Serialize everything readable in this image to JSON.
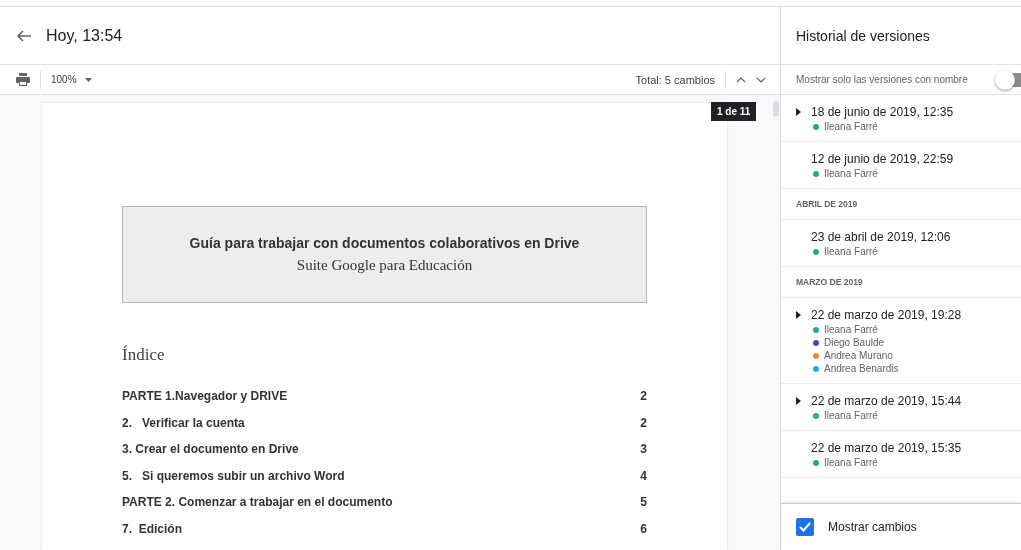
{
  "header": {
    "title": "Hoy, 13:54"
  },
  "toolbar": {
    "zoom": "100%",
    "total": "Total: 5 cambios",
    "tooltip": "1 de 11"
  },
  "document": {
    "title": "Guía para trabajar con documentos colaborativos en Drive",
    "subtitle": "Suite Google para Educación",
    "index_heading": "Índice",
    "toc": [
      {
        "text": "PARTE 1.Navegador y DRIVE",
        "page": "2"
      },
      {
        "text": "2.   Verificar la cuenta",
        "page": "2"
      },
      {
        "text": "3. Crear el documento en Drive",
        "page": "3"
      },
      {
        "text": "5.   Si queremos subir un archivo Word",
        "page": "4"
      },
      {
        "text": "PARTE 2. Comenzar a trabajar en el documento",
        "page": "5"
      },
      {
        "text": "7.  Edición",
        "page": "6"
      }
    ]
  },
  "panel": {
    "title": "Historial de versiones",
    "filter_label": "Mostrar solo las versiones con nombre",
    "filter_on": false,
    "items": [
      {
        "kind": "version",
        "date": "18 de junio de 2019, 12:35",
        "expandable": true,
        "authors": [
          {
            "name": "Ileana Farré",
            "color": "#26a69a"
          }
        ]
      },
      {
        "kind": "version",
        "date": "12 de junio de 2019, 22:59",
        "expandable": false,
        "authors": [
          {
            "name": "Ileana Farré",
            "color": "#26a69a"
          }
        ]
      },
      {
        "kind": "month",
        "label": "ABRIL DE 2019"
      },
      {
        "kind": "version",
        "date": "23 de abril de 2019, 12:06",
        "expandable": false,
        "authors": [
          {
            "name": "Ileana Farré",
            "color": "#26a69a"
          }
        ]
      },
      {
        "kind": "month",
        "label": "MARZO DE 2019"
      },
      {
        "kind": "version",
        "date": "22 de marzo de 2019, 19:28",
        "expandable": true,
        "authors": [
          {
            "name": "Ileana Farré",
            "color": "#26a69a"
          },
          {
            "name": "Diego Baulde",
            "color": "#673ab7"
          },
          {
            "name": "Andrea Murano",
            "color": "#ef8b2c"
          },
          {
            "name": "Andrea Benardis",
            "color": "#26a8e0"
          }
        ]
      },
      {
        "kind": "version",
        "date": "22 de marzo de 2019, 15:44",
        "expandable": true,
        "authors": [
          {
            "name": "Ileana Farré",
            "color": "#26a69a"
          }
        ]
      },
      {
        "kind": "version",
        "date": "22 de marzo de 2019, 15:35",
        "expandable": false,
        "authors": [
          {
            "name": "Ileana Farré",
            "color": "#26a69a"
          }
        ]
      }
    ],
    "show_changes": {
      "label": "Mostrar cambios",
      "checked": true
    }
  }
}
